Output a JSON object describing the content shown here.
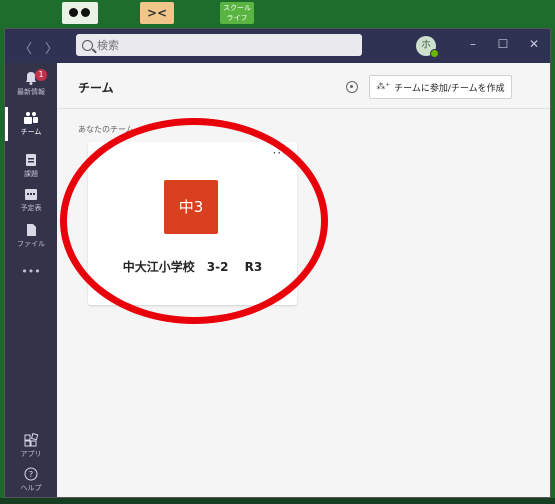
{
  "desktop": {
    "icons": [
      {
        "name": "panda-app-icon"
      },
      {
        "name": "face-app-icon",
        "label": "><"
      },
      {
        "name": "school-life-app-icon",
        "label": "スクール ライフ"
      }
    ]
  },
  "titlebar": {
    "back": "〈",
    "forward": "〉",
    "search_placeholder": "検索",
    "avatar_initial": "ホ",
    "min": "–",
    "max": "☐",
    "close": "✕"
  },
  "rail": {
    "activity": {
      "label": "最新情報",
      "badge": "1"
    },
    "teams": {
      "label": "チーム"
    },
    "assignments": {
      "label": "課題"
    },
    "calendar": {
      "label": "予定表"
    },
    "files": {
      "label": "ファイル"
    },
    "more": "•••",
    "apps": {
      "label": "アプリ"
    },
    "help": {
      "label": "ヘルプ"
    }
  },
  "main": {
    "title": "チーム",
    "join_button": "チームに参加/チームを作成",
    "section_label": "あなたのチーム",
    "teams": [
      {
        "tile": "中3",
        "name": "中大江小学校　3-2　 R3",
        "more": "···"
      }
    ]
  },
  "colors": {
    "rail": "#33344a",
    "titlebar": "#2f3252",
    "team_tile": "#d9401f",
    "annotation_circle": "#e8000b"
  }
}
